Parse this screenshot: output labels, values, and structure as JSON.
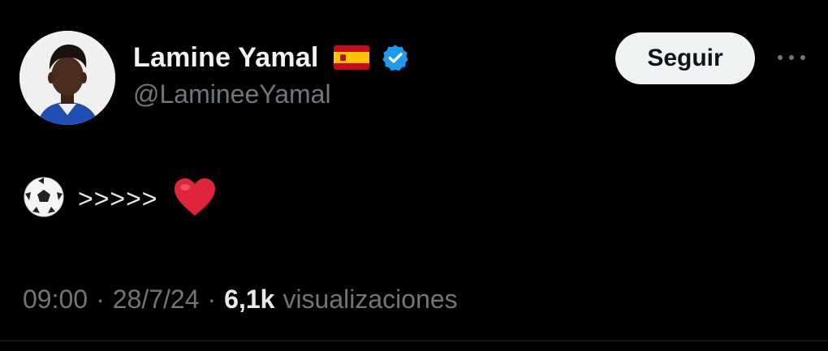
{
  "user": {
    "display_name": "Lamine Yamal",
    "flag_emoji": "spain-flag",
    "verified_icon": "verified-badge-icon",
    "handle": "@LamineeYamal",
    "avatar_icon": "profile-photo"
  },
  "actions": {
    "follow_label": "Seguir",
    "more_icon": "more-options-icon"
  },
  "tweet": {
    "emoji_1": "soccer-ball-emoji",
    "text": ">>>>>",
    "emoji_2": "red-heart-emoji"
  },
  "meta": {
    "time": "09:00",
    "separator": "·",
    "date": "28/7/24",
    "views_count": "6,1k",
    "views_label": "visualizaciones"
  },
  "colors": {
    "background": "#000000",
    "primary_text": "#e7e9ea",
    "secondary_text": "#71767b",
    "verified_blue": "#1d9bf0",
    "follow_bg": "#eff3f4",
    "heart_red": "#e0243b"
  }
}
